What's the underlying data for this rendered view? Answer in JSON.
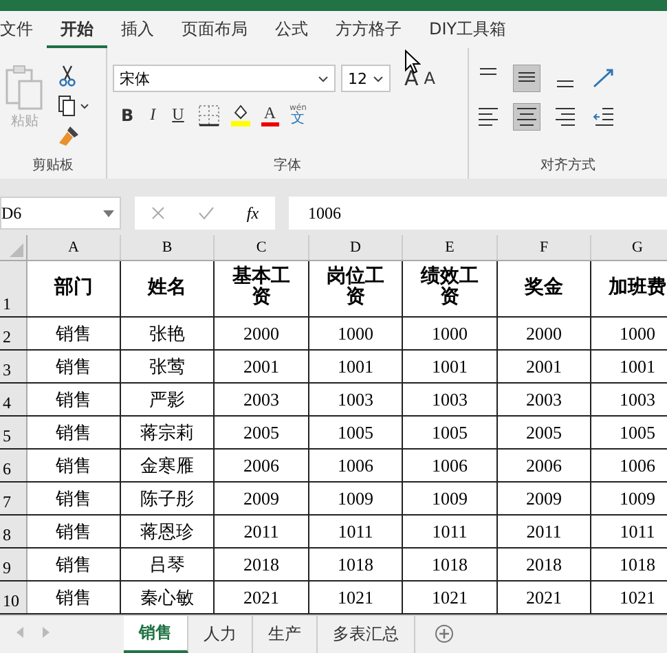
{
  "tabs": [
    {
      "label": "文件",
      "selected": false
    },
    {
      "label": "开始",
      "selected": true
    },
    {
      "label": "插入",
      "selected": false
    },
    {
      "label": "页面布局",
      "selected": false
    },
    {
      "label": "公式",
      "selected": false
    },
    {
      "label": "方方格子",
      "selected": false
    },
    {
      "label": "DIY工具箱",
      "selected": false
    }
  ],
  "ribbon": {
    "clipboard": {
      "paste_label": "粘贴",
      "group_label": "剪贴板"
    },
    "font": {
      "font_name": "宋体",
      "font_size": "12",
      "grow": "A",
      "shrink": "A",
      "bold": "B",
      "italic": "I",
      "underline": "U",
      "font_color": "A",
      "phonetic_top": "wén",
      "phonetic": "文",
      "group_label": "字体"
    },
    "alignment": {
      "group_label": "对齐方式",
      "vertical": [
        {
          "kind": "top",
          "selected": false
        },
        {
          "kind": "middle",
          "selected": true
        },
        {
          "kind": "bottom",
          "selected": false
        }
      ],
      "horizontal": [
        {
          "kind": "left",
          "selected": false
        },
        {
          "kind": "center",
          "selected": true
        },
        {
          "kind": "right",
          "selected": false
        }
      ]
    }
  },
  "formula_bar": {
    "name_box": "D6",
    "fx": "fx",
    "value": "1006"
  },
  "sheet": {
    "columns": [
      "A",
      "B",
      "C",
      "D",
      "E",
      "F",
      "G"
    ],
    "header_row": {
      "number": "1",
      "cells": [
        "部门",
        "姓名",
        "基本工资",
        "岗位工资",
        "绩效工资",
        "奖金",
        "加班费"
      ]
    },
    "rows": [
      {
        "number": "2",
        "cells": [
          "销售",
          "张艳",
          "2000",
          "1000",
          "1000",
          "2000",
          "1000"
        ]
      },
      {
        "number": "3",
        "cells": [
          "销售",
          "张莺",
          "2001",
          "1001",
          "1001",
          "2001",
          "1001"
        ]
      },
      {
        "number": "4",
        "cells": [
          "销售",
          "严影",
          "2003",
          "1003",
          "1003",
          "2003",
          "1003"
        ]
      },
      {
        "number": "5",
        "cells": [
          "销售",
          "蒋宗莉",
          "2005",
          "1005",
          "1005",
          "2005",
          "1005"
        ]
      },
      {
        "number": "6",
        "cells": [
          "销售",
          "金寒雁",
          "2006",
          "1006",
          "1006",
          "2006",
          "1006"
        ]
      },
      {
        "number": "7",
        "cells": [
          "销售",
          "陈子彤",
          "2009",
          "1009",
          "1009",
          "2009",
          "1009"
        ]
      },
      {
        "number": "8",
        "cells": [
          "销售",
          "蒋恩珍",
          "2011",
          "1011",
          "1011",
          "2011",
          "1011"
        ]
      },
      {
        "number": "9",
        "cells": [
          "销售",
          "吕琴",
          "2018",
          "1018",
          "1018",
          "2018",
          "1018"
        ]
      },
      {
        "number": "10",
        "cells": [
          "销售",
          "秦心敏",
          "2021",
          "1021",
          "1021",
          "2021",
          "1021"
        ]
      }
    ]
  },
  "sheet_tabs": [
    {
      "label": "销售",
      "selected": true
    },
    {
      "label": "人力",
      "selected": false
    },
    {
      "label": "生产",
      "selected": false
    },
    {
      "label": "多表汇总",
      "selected": false
    }
  ]
}
